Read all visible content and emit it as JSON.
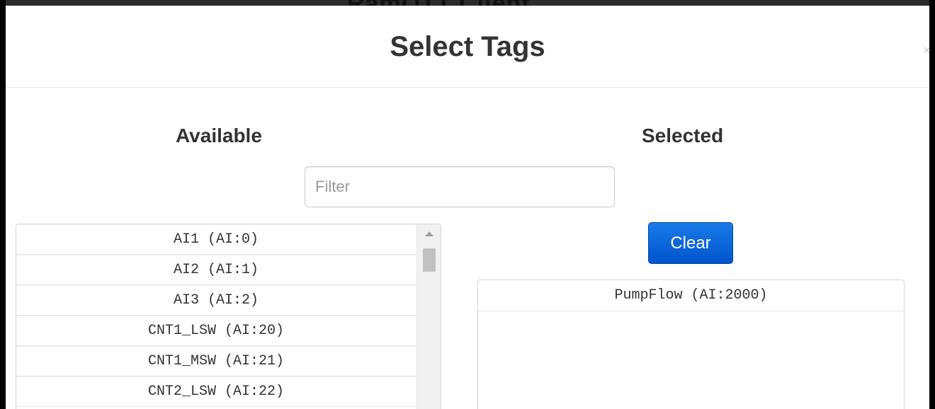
{
  "background_title": "RamOTT Client",
  "modal": {
    "title": "Select Tags",
    "close_icon": "close-icon"
  },
  "available": {
    "heading": "Available",
    "filter": {
      "value": "",
      "placeholder": "Filter"
    },
    "items": [
      "AI1 (AI:0)",
      "AI2 (AI:1)",
      "AI3 (AI:2)",
      "CNT1_LSW (AI:20)",
      "CNT1_MSW (AI:21)",
      "CNT2_LSW (AI:22)"
    ]
  },
  "selected": {
    "heading": "Selected",
    "clear_label": "Clear",
    "items": [
      "PumpFlow (AI:2000)"
    ]
  },
  "colors": {
    "primary_button": "#0066dd",
    "text": "#333333",
    "border": "#d6d6d6"
  }
}
